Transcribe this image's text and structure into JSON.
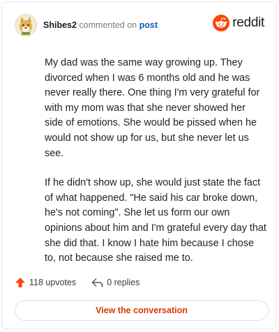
{
  "header": {
    "username": "Shibes2",
    "commented_on": "commented on",
    "post_link": "post"
  },
  "brand": {
    "name": "reddit",
    "color": "#ff4500"
  },
  "comment": {
    "paragraphs": [
      "My dad was the same way growing up. They divorced when I was 6 months old and he was never really there. One thing I'm very grateful for with my mom was that she never showed her side of emotions. She would be pissed when he would not show up for us, but she never let us see.",
      "If he didn't show up, she would just state the fact of what happened. \"He said his car broke down, he's not coming\". She let us form our own opinions about him and I'm grateful every day that she did that. I know I hate him because I chose to, not because she raised me to."
    ]
  },
  "actions": {
    "upvotes": "118 upvotes",
    "upvote_icon": "upvote-arrow-icon",
    "upvote_color": "#ff4500",
    "replies": "0 replies",
    "reply_icon": "reply-arrow-icon"
  },
  "cta": {
    "label": "View the conversation",
    "color": "#d93a00"
  }
}
